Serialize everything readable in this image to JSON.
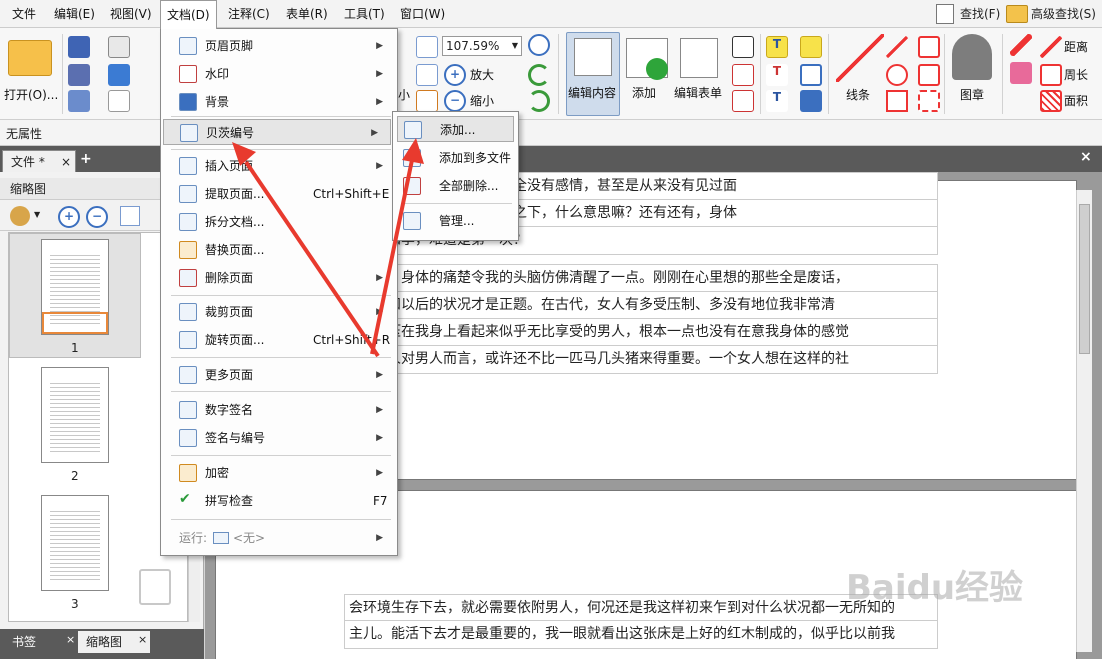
{
  "menubar": {
    "items": [
      "文件",
      "编辑(E)",
      "视图(V)",
      "文档(D)",
      "注释(C)",
      "表单(R)",
      "工具(T)",
      "窗口(W)"
    ],
    "find": "查找(F)",
    "advanced_find": "高级查找(S)"
  },
  "ribbon": {
    "open": "打开(O)...",
    "zoom_value": "107.59%",
    "zoom_in": "放大",
    "zoom_out": "缩小",
    "small": "小",
    "edit_content": "编辑内容",
    "add": "添加",
    "edit_form": "编辑表单",
    "lines": "线条",
    "stamp": "图章",
    "distance": "距离",
    "perimeter": "周长",
    "area": "面积"
  },
  "propbar": {
    "label": "无属性"
  },
  "tabs": {
    "file_tab": "文件 *",
    "close": "×",
    "add": "+"
  },
  "left_panel": {
    "title": "缩略图",
    "pages": [
      "1",
      "2",
      "3"
    ],
    "bottom_tabs": [
      "书签",
      "缩略图"
    ]
  },
  "document_menu": {
    "items": [
      {
        "label": "页眉页脚",
        "arrow": true
      },
      {
        "label": "水印",
        "arrow": true
      },
      {
        "label": "背景",
        "arrow": true
      },
      {
        "label": "贝茨编号",
        "arrow": true
      },
      {
        "label": "插入页面",
        "arrow": true
      },
      {
        "label": "提取页面...",
        "shortcut": "Ctrl+Shift+E"
      },
      {
        "label": "拆分文档..."
      },
      {
        "label": "替换页面..."
      },
      {
        "label": "删除页面",
        "arrow": true
      },
      {
        "label": "裁剪页面",
        "arrow": true
      },
      {
        "label": "旋转页面...",
        "shortcut": "Ctrl+Shift+R"
      },
      {
        "label": "更多页面",
        "arrow": true
      },
      {
        "label": "数字签名",
        "arrow": true
      },
      {
        "label": "签名与编号",
        "arrow": true
      },
      {
        "label": "加密",
        "arrow": true
      },
      {
        "label": "拼写检查",
        "shortcut": "F7"
      }
    ],
    "run_label": "运行:",
    "run_value": "<无>"
  },
  "bates_submenu": {
    "items": [
      "添加...",
      "添加到多文件",
      "全部删除...",
      "管理..."
    ]
  },
  "page_text": {
    "p1_lines": [
      "没有的情况下，安排我跟完全没有感情，甚至是从来没有见过面",
      "面，还是在这种尴尬的情况之下，什么意思嘛？还有还有，身体",
      "那也会四季，难道是第一次？",
      "",
      "睁大眼，身体的痛楚令我的头脑仿佛清醒了一点。刚刚在心里想的那些全是废话，",
      "对眼前和以后的状况才是正题。在古代，女人有多受压制、多没有地位我非常清",
      "像这个压在我身上看起来似乎无比享受的男人，根本一点也没有在意我身体的感觉",
      "的，女人对男人而言，或许还不比一匹马几头猪来得重要。一个女人想在这样的社"
    ],
    "p2_lines": [
      "会环境生存下去，就必需要依附男人，何况还是我这样初来乍到对什么状况都一无所知的",
      "主儿。能活下去才是最重要的，我一眼就看出这张床是上好的红木制成的，似乎比以前我"
    ]
  },
  "watermark": "Baidu经验",
  "colors": {
    "accent": "#2a6bbf",
    "arrow": "#e83a2e",
    "highlight": "#e6e6e6"
  }
}
